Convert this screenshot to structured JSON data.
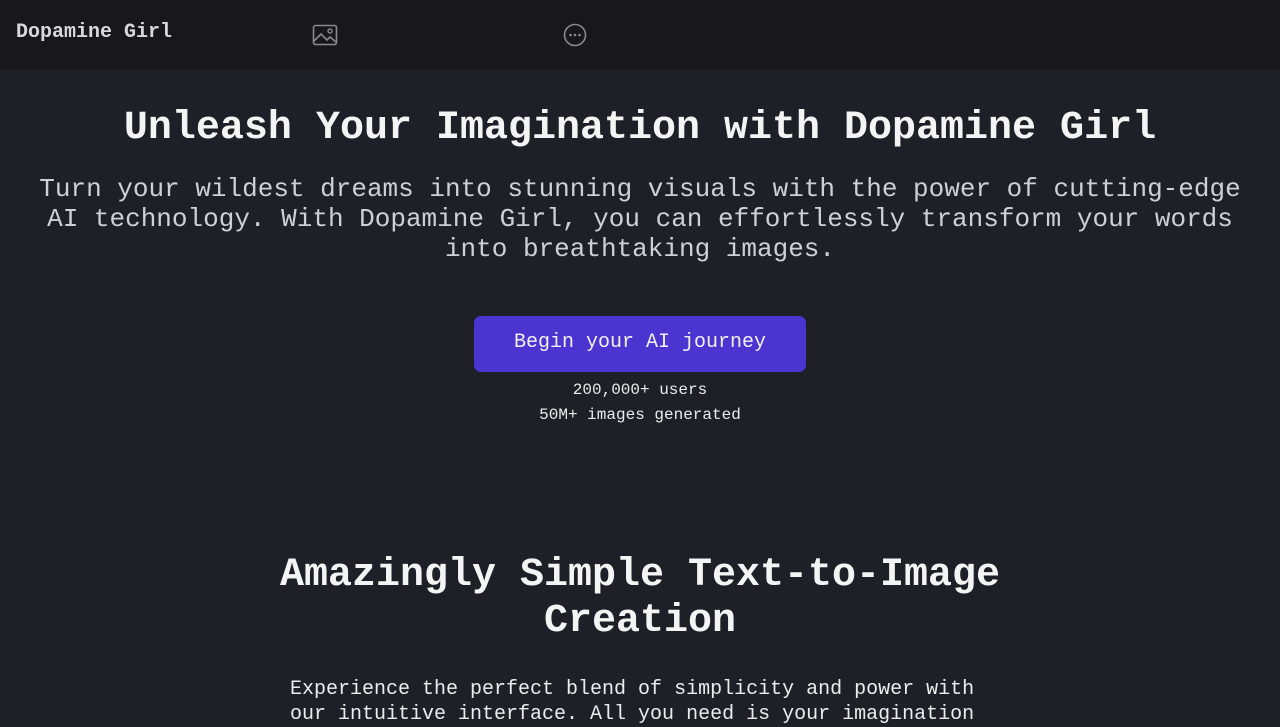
{
  "header": {
    "brand": "Dopamine Girl",
    "icons": [
      "image-icon",
      "more-options-icon"
    ]
  },
  "hero": {
    "title": "Unleash Your Imagination with Dopamine Girl",
    "description": "Turn your wildest dreams into stunning visuals with the power of cutting-edge AI technology. With Dopamine Girl, you can effortlessly transform your words into breathtaking images.",
    "cta_label": "Begin your AI journey",
    "stats": [
      "200,000+ users",
      "50M+ images generated"
    ]
  },
  "features": {
    "title": "Amazingly Simple Text-to-Image Creation",
    "description": "Experience the perfect blend of simplicity and power with our intuitive interface. All you need is your imagination"
  },
  "colors": {
    "background": "#1f1f27",
    "header_background": "#18181b",
    "accent": "#4a35d0"
  }
}
